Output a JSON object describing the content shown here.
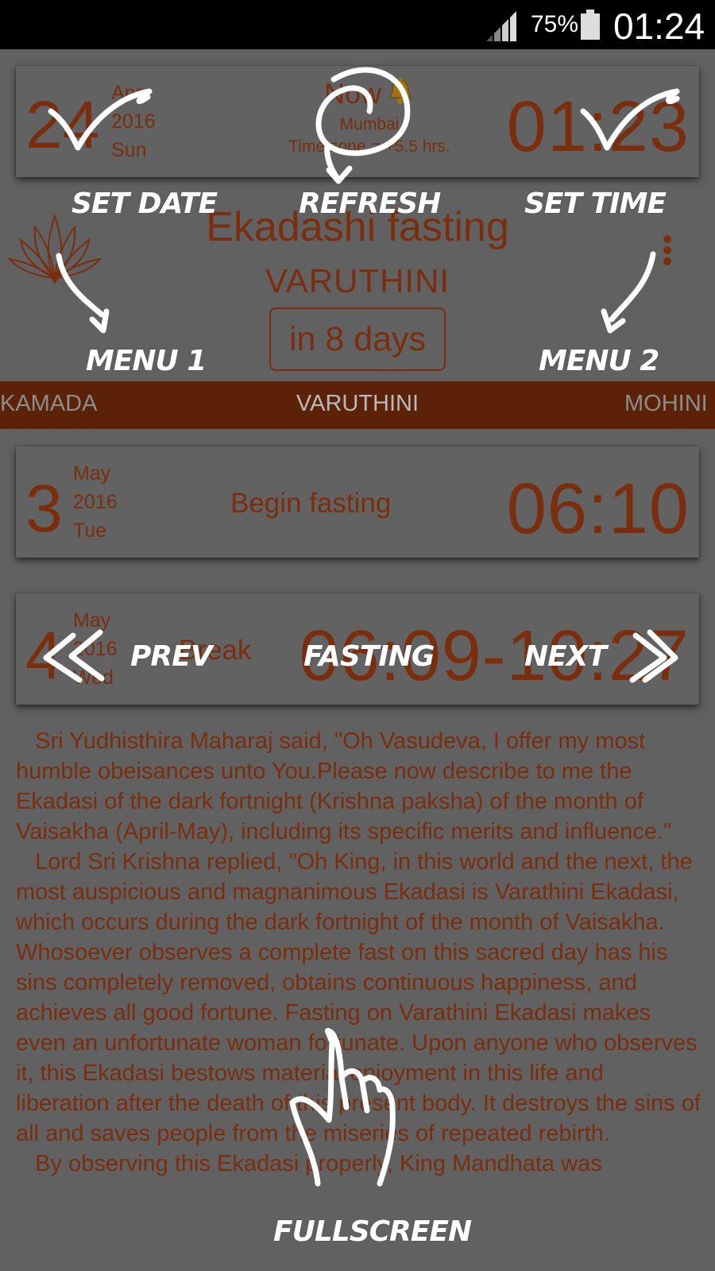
{
  "status_bar": {
    "battery_percent": "75%",
    "time": "01:24"
  },
  "now_card": {
    "day": "24",
    "month": "Apr",
    "year": "2016",
    "weekday": "Sun",
    "title": "Now",
    "city": "Mumbai",
    "timezone": "Time zone = +5.5 hrs.",
    "time": "01:23"
  },
  "header": {
    "title": "Ekadashi fasting",
    "subtitle": "VARUTHINI",
    "countdown": "in 8 days"
  },
  "tabs": {
    "previous": "KAMADA",
    "current": "VARUTHINI",
    "next": "MOHINI"
  },
  "begin_card": {
    "day": "3",
    "month": "May",
    "year": "2016",
    "weekday": "Tue",
    "label": "Begin fasting",
    "time": "06:10"
  },
  "break_card": {
    "day": "4",
    "month": "May",
    "year": "2016",
    "weekday": "Wed",
    "label": "Break",
    "time": "06:09-10:27"
  },
  "story": [
    "   Sri Yudhisthira Maharaj said, \"Oh Vasudeva, I offer my most humble obeisances unto You.Please now describe to me the Ekadasi of the dark fortnight (Krishna paksha) of the month of Vaisakha (April-May), including its specific merits and influence.\"",
    "   Lord Sri Krishna replied, \"Oh King, in this world and the next, the most auspicious and magnanimous Ekadasi is Varathini Ekadasi, which occurs during the dark fortnight of the month of Vaisakha.",
    "Whosoever observes a complete fast on this sacred day has his sins completely removed, obtains continuous happiness, and achieves all good fortune. Fasting on Varathini Ekadasi makes even an unfortunate woman fortunate. Upon anyone who observes it, this Ekadasi bestows material enjoyment in this life and liberation after the death of this present body. It destroys the sins of all and saves people from the miseries of repeated rebirth.",
    "   By observing this Ekadasi properly, King Mandhata was"
  ],
  "hints": {
    "set_date": "SET DATE",
    "refresh": "REFRESH",
    "set_time": "SET TIME",
    "menu1": "MENU 1",
    "menu2": "MENU 2",
    "prev": "PREV",
    "fasting": "FASTING",
    "next": "NEXT",
    "fullscreen": "FULLSCREEN"
  },
  "colors": {
    "background": "#616161",
    "accent_text": "#7a2e0e",
    "tab_strip": "#5c2207",
    "annotation": "#ffffff"
  },
  "icons": {
    "signal": "signal-icon",
    "battery": "battery-icon",
    "bell": "bell-icon",
    "lotus": "lotus-icon",
    "overflow": "overflow-menu-icon"
  }
}
